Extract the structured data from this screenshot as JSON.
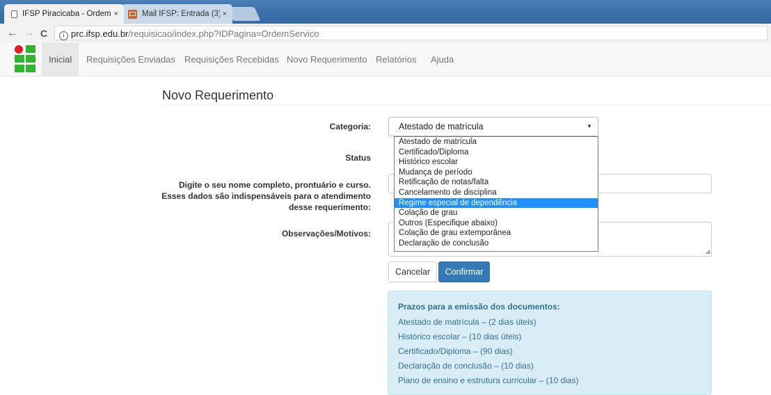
{
  "browser": {
    "tabs": [
      {
        "title": "IFSP Piracicaba - Ordem",
        "close": "×"
      },
      {
        "title": "Mail IFSP: Entrada (3)",
        "close": "×"
      }
    ],
    "back": "←",
    "forward": "→",
    "reload": "C",
    "url_host": "prc.ifsp.edu.br",
    "url_path": "/requisicao/index.php?IDPagina=OrdemServico"
  },
  "navbar": {
    "items": [
      "Inicial",
      "Requisições Enviadas",
      "Requisições Recebidas",
      "Novo Requerimento",
      "Relatórios",
      "Ajuda"
    ]
  },
  "page": {
    "title": "Novo Requerimento"
  },
  "form": {
    "categoria_label": "Categoria:",
    "categoria_value": "Atestado de matrícula",
    "status_label": "Status",
    "nome_label_1": "Digite o seu nome completo, prontuário e curso.",
    "nome_label_2": "Esses dados são indispensáveis para o atendimento",
    "nome_label_3": "desse requerimento:",
    "obs_label": "Observações/Motivos:",
    "options": [
      "Atestado de matrícula",
      "Certificado/Diploma",
      "Histórico escolar",
      "Mudança de período",
      "Retificação de notas/falta",
      "Cancelamento de disciplina",
      "Regime especial de dependência",
      "Colação de grau",
      "Outros (Especifique abaixo)",
      "Colação de grau extemporânea",
      "Declaração de conclusão"
    ],
    "highlighted_option": "Regime especial de dependência",
    "cancel_label": "Cancelar",
    "confirm_label": "Confirmar"
  },
  "info": {
    "title": "Prazos para a emissão dos documentos:",
    "lines": [
      "Atestado de matrícula – (2 dias úteis)",
      "Histórico escolar – (10 dias úteis)",
      "Certificado/Diploma – (90 dias)",
      "Declaração de conclusão – (10 dias)",
      "Plano de ensino e estrutura curricular – (10 dias)"
    ]
  },
  "colors": {
    "primary": "#337ab7",
    "info_bg": "#d9edf7",
    "info_text": "#31708f",
    "highlight": "#1e90ff",
    "logo_green": "#2fb52f",
    "logo_red": "#e21c23"
  }
}
